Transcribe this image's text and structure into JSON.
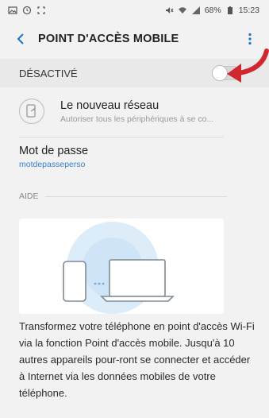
{
  "status_bar": {
    "icons_left": [
      "gallery-icon",
      "alarm-icon",
      "screenshot-icon"
    ],
    "icons_right": [
      "mute-icon",
      "wifi-icon",
      "signal-icon"
    ],
    "battery": "68%",
    "time": "15:23"
  },
  "header": {
    "title": "POINT D'ACCÈS MOBILE",
    "back_icon": "chevron-left-icon",
    "more_icon": "more-vert-icon"
  },
  "toggle": {
    "label": "DÉSACTIVÉ",
    "state": "off"
  },
  "network": {
    "icon": "device-share-icon",
    "name": "Le nouveau réseau",
    "description": "Autoriser tous les périphériques à se co..."
  },
  "password": {
    "label": "Mot de passe",
    "value": "motdepasseperso"
  },
  "aide": {
    "label": "AIDE",
    "text": "Transformez votre téléphone en point d'accès Wi-Fi via la fonction Point d'accès mobile. Jusqu'à 10 autres appareils pour-ront se connecter et accéder à Internet via les données mobiles de votre téléphone."
  },
  "colors": {
    "accent": "#1b73c9",
    "arrow": "#d0282e",
    "background": "#f2f2f2"
  }
}
